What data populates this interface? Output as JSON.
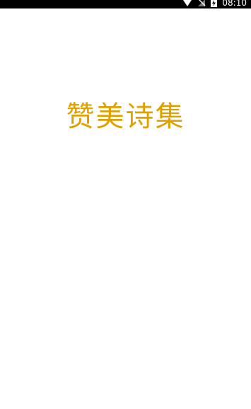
{
  "status_bar": {
    "time": "08:10",
    "icons": [
      "wifi-icon",
      "no-signal-icon",
      "battery-charging-icon"
    ]
  },
  "splash": {
    "title": "赞美诗集"
  },
  "colors": {
    "title": "#e0a100",
    "status_bar_bg": "#000000",
    "background": "#ffffff"
  }
}
